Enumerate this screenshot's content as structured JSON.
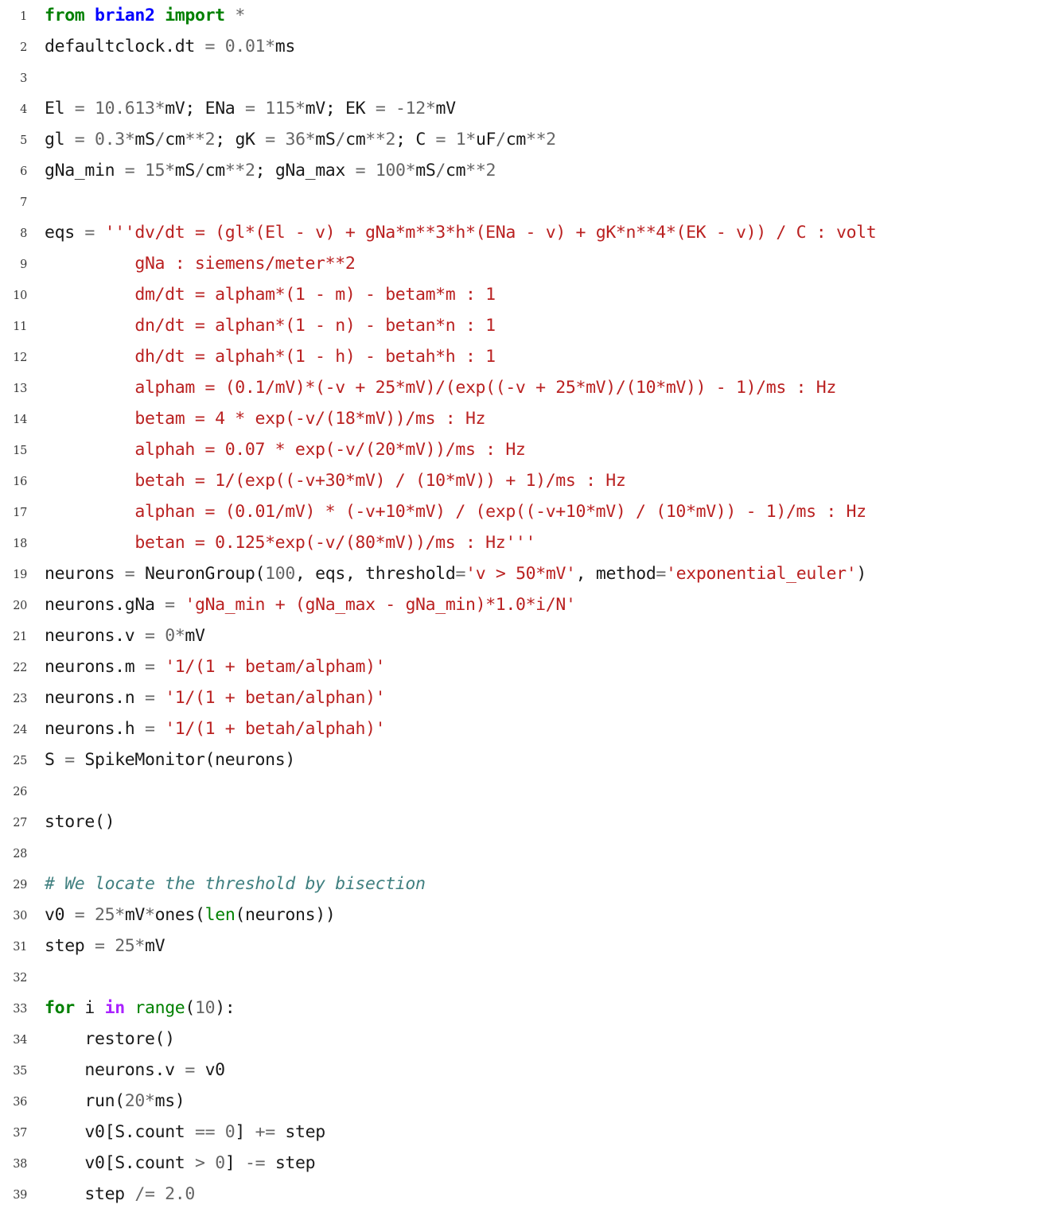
{
  "listing": {
    "language": "python",
    "colors": {
      "keyword": "#008000",
      "namespace": "#0000ff",
      "builtin": "#008000",
      "operator_word": "#aa22ff",
      "string": "#ba2121",
      "comment": "#408080",
      "number": "#666666",
      "name": "#1a1a1a",
      "lineno": "#3a3a3a",
      "background": "#ffffff"
    },
    "first_line_number": 1,
    "last_line_number": 39,
    "lines": [
      {
        "n": "1",
        "text": "from brian2 import *"
      },
      {
        "n": "2",
        "text": "defaultclock.dt = 0.01*ms"
      },
      {
        "n": "3",
        "text": ""
      },
      {
        "n": "4",
        "text": "El = 10.613*mV; ENa = 115*mV; EK = -12*mV"
      },
      {
        "n": "5",
        "text": "gl = 0.3*mS/cm**2; gK = 36*mS/cm**2; C = 1*uF/cm**2"
      },
      {
        "n": "6",
        "text": "gNa_min = 15*mS/cm**2; gNa_max = 100*mS/cm**2"
      },
      {
        "n": "7",
        "text": ""
      },
      {
        "n": "8",
        "text": "eqs = '''dv/dt = (gl*(El - v) + gNa*m**3*h*(ENa - v) + gK*n**4*(EK - v)) / C : volt"
      },
      {
        "n": "9",
        "text": "         gNa : siemens/meter**2"
      },
      {
        "n": "10",
        "text": "         dm/dt = alpham*(1 - m) - betam*m : 1"
      },
      {
        "n": "11",
        "text": "         dn/dt = alphan*(1 - n) - betan*n : 1"
      },
      {
        "n": "12",
        "text": "         dh/dt = alphah*(1 - h) - betah*h : 1"
      },
      {
        "n": "13",
        "text": "         alpham = (0.1/mV)*(-v + 25*mV)/(exp((-v + 25*mV)/(10*mV)) - 1)/ms : Hz"
      },
      {
        "n": "14",
        "text": "         betam = 4 * exp(-v/(18*mV))/ms : Hz"
      },
      {
        "n": "15",
        "text": "         alphah = 0.07 * exp(-v/(20*mV))/ms : Hz"
      },
      {
        "n": "16",
        "text": "         betah = 1/(exp((-v+30*mV) / (10*mV)) + 1)/ms : Hz"
      },
      {
        "n": "17",
        "text": "         alphan = (0.01/mV) * (-v+10*mV) / (exp((-v+10*mV) / (10*mV)) - 1)/ms : Hz"
      },
      {
        "n": "18",
        "text": "         betan = 0.125*exp(-v/(80*mV))/ms : Hz'''"
      },
      {
        "n": "19",
        "text": "neurons = NeuronGroup(100, eqs, threshold='v > 50*mV', method='exponential_euler')"
      },
      {
        "n": "20",
        "text": "neurons.gNa = 'gNa_min + (gNa_max - gNa_min)*1.0*i/N'"
      },
      {
        "n": "21",
        "text": "neurons.v = 0*mV"
      },
      {
        "n": "22",
        "text": "neurons.m = '1/(1 + betam/alpham)'"
      },
      {
        "n": "23",
        "text": "neurons.n = '1/(1 + betan/alphan)'"
      },
      {
        "n": "24",
        "text": "neurons.h = '1/(1 + betah/alphah)'"
      },
      {
        "n": "25",
        "text": "S = SpikeMonitor(neurons)"
      },
      {
        "n": "26",
        "text": ""
      },
      {
        "n": "27",
        "text": "store()"
      },
      {
        "n": "28",
        "text": ""
      },
      {
        "n": "29",
        "text": "# We locate the threshold by bisection"
      },
      {
        "n": "30",
        "text": "v0 = 25*mV*ones(len(neurons))"
      },
      {
        "n": "31",
        "text": "step = 25*mV"
      },
      {
        "n": "32",
        "text": ""
      },
      {
        "n": "33",
        "text": "for i in range(10):"
      },
      {
        "n": "34",
        "text": "    restore()"
      },
      {
        "n": "35",
        "text": "    neurons.v = v0"
      },
      {
        "n": "36",
        "text": "    run(20*ms)"
      },
      {
        "n": "37",
        "text": "    v0[S.count == 0] += step"
      },
      {
        "n": "38",
        "text": "    v0[S.count > 0] -= step"
      },
      {
        "n": "39",
        "text": "    step /= 2.0"
      }
    ],
    "tokens": [
      [
        {
          "t": "kn",
          "v": "from"
        },
        {
          "t": "n",
          "v": " "
        },
        {
          "t": "nn",
          "v": "brian2"
        },
        {
          "t": "n",
          "v": " "
        },
        {
          "t": "kn",
          "v": "import"
        },
        {
          "t": "o",
          "v": " *"
        }
      ],
      [
        {
          "t": "n",
          "v": "defaultclock"
        },
        {
          "t": "p",
          "v": "."
        },
        {
          "t": "n",
          "v": "dt "
        },
        {
          "t": "o",
          "v": "="
        },
        {
          "t": "n",
          "v": " "
        },
        {
          "t": "m",
          "v": "0.01"
        },
        {
          "t": "o",
          "v": "*"
        },
        {
          "t": "n",
          "v": "ms"
        }
      ],
      [],
      [
        {
          "t": "n",
          "v": "El "
        },
        {
          "t": "o",
          "v": "="
        },
        {
          "t": "n",
          "v": " "
        },
        {
          "t": "m",
          "v": "10.613"
        },
        {
          "t": "o",
          "v": "*"
        },
        {
          "t": "n",
          "v": "mV"
        },
        {
          "t": "p",
          "v": ";"
        },
        {
          "t": "n",
          "v": " ENa "
        },
        {
          "t": "o",
          "v": "="
        },
        {
          "t": "n",
          "v": " "
        },
        {
          "t": "m",
          "v": "115"
        },
        {
          "t": "o",
          "v": "*"
        },
        {
          "t": "n",
          "v": "mV"
        },
        {
          "t": "p",
          "v": ";"
        },
        {
          "t": "n",
          "v": " EK "
        },
        {
          "t": "o",
          "v": "="
        },
        {
          "t": "n",
          "v": " "
        },
        {
          "t": "o",
          "v": "-"
        },
        {
          "t": "m",
          "v": "12"
        },
        {
          "t": "o",
          "v": "*"
        },
        {
          "t": "n",
          "v": "mV"
        }
      ],
      [
        {
          "t": "n",
          "v": "gl "
        },
        {
          "t": "o",
          "v": "="
        },
        {
          "t": "n",
          "v": " "
        },
        {
          "t": "m",
          "v": "0.3"
        },
        {
          "t": "o",
          "v": "*"
        },
        {
          "t": "n",
          "v": "mS"
        },
        {
          "t": "o",
          "v": "/"
        },
        {
          "t": "n",
          "v": "cm"
        },
        {
          "t": "o",
          "v": "**"
        },
        {
          "t": "m",
          "v": "2"
        },
        {
          "t": "p",
          "v": ";"
        },
        {
          "t": "n",
          "v": " gK "
        },
        {
          "t": "o",
          "v": "="
        },
        {
          "t": "n",
          "v": " "
        },
        {
          "t": "m",
          "v": "36"
        },
        {
          "t": "o",
          "v": "*"
        },
        {
          "t": "n",
          "v": "mS"
        },
        {
          "t": "o",
          "v": "/"
        },
        {
          "t": "n",
          "v": "cm"
        },
        {
          "t": "o",
          "v": "**"
        },
        {
          "t": "m",
          "v": "2"
        },
        {
          "t": "p",
          "v": ";"
        },
        {
          "t": "n",
          "v": " C "
        },
        {
          "t": "o",
          "v": "="
        },
        {
          "t": "n",
          "v": " "
        },
        {
          "t": "m",
          "v": "1"
        },
        {
          "t": "o",
          "v": "*"
        },
        {
          "t": "n",
          "v": "uF"
        },
        {
          "t": "o",
          "v": "/"
        },
        {
          "t": "n",
          "v": "cm"
        },
        {
          "t": "o",
          "v": "**"
        },
        {
          "t": "m",
          "v": "2"
        }
      ],
      [
        {
          "t": "n",
          "v": "gNa_min "
        },
        {
          "t": "o",
          "v": "="
        },
        {
          "t": "n",
          "v": " "
        },
        {
          "t": "m",
          "v": "15"
        },
        {
          "t": "o",
          "v": "*"
        },
        {
          "t": "n",
          "v": "mS"
        },
        {
          "t": "o",
          "v": "/"
        },
        {
          "t": "n",
          "v": "cm"
        },
        {
          "t": "o",
          "v": "**"
        },
        {
          "t": "m",
          "v": "2"
        },
        {
          "t": "p",
          "v": ";"
        },
        {
          "t": "n",
          "v": " gNa_max "
        },
        {
          "t": "o",
          "v": "="
        },
        {
          "t": "n",
          "v": " "
        },
        {
          "t": "m",
          "v": "100"
        },
        {
          "t": "o",
          "v": "*"
        },
        {
          "t": "n",
          "v": "mS"
        },
        {
          "t": "o",
          "v": "/"
        },
        {
          "t": "n",
          "v": "cm"
        },
        {
          "t": "o",
          "v": "**"
        },
        {
          "t": "m",
          "v": "2"
        }
      ],
      [],
      [
        {
          "t": "n",
          "v": "eqs "
        },
        {
          "t": "o",
          "v": "="
        },
        {
          "t": "n",
          "v": " "
        },
        {
          "t": "s",
          "v": "'''dv/dt = (gl*(El - v) + gNa*m**3*h*(ENa - v) + gK*n**4*(EK - v)) / C : volt"
        }
      ],
      [
        {
          "t": "s",
          "v": "         gNa : siemens/meter**2"
        }
      ],
      [
        {
          "t": "s",
          "v": "         dm/dt = alpham*(1 - m) - betam*m : 1"
        }
      ],
      [
        {
          "t": "s",
          "v": "         dn/dt = alphan*(1 - n) - betan*n : 1"
        }
      ],
      [
        {
          "t": "s",
          "v": "         dh/dt = alphah*(1 - h) - betah*h : 1"
        }
      ],
      [
        {
          "t": "s",
          "v": "         alpham = (0.1/mV)*(-v + 25*mV)/(exp((-v + 25*mV)/(10*mV)) - 1)/ms : Hz"
        }
      ],
      [
        {
          "t": "s",
          "v": "         betam = 4 * exp(-v/(18*mV))/ms : Hz"
        }
      ],
      [
        {
          "t": "s",
          "v": "         alphah = 0.07 * exp(-v/(20*mV))/ms : Hz"
        }
      ],
      [
        {
          "t": "s",
          "v": "         betah = 1/(exp((-v+30*mV) / (10*mV)) + 1)/ms : Hz"
        }
      ],
      [
        {
          "t": "s",
          "v": "         alphan = (0.01/mV) * (-v+10*mV) / (exp((-v+10*mV) / (10*mV)) - 1)/ms : Hz"
        }
      ],
      [
        {
          "t": "s",
          "v": "         betan = 0.125*exp(-v/(80*mV))/ms : Hz'''"
        }
      ],
      [
        {
          "t": "n",
          "v": "neurons "
        },
        {
          "t": "o",
          "v": "="
        },
        {
          "t": "n",
          "v": " NeuronGroup"
        },
        {
          "t": "p",
          "v": "("
        },
        {
          "t": "m",
          "v": "100"
        },
        {
          "t": "p",
          "v": ","
        },
        {
          "t": "n",
          "v": " eqs"
        },
        {
          "t": "p",
          "v": ","
        },
        {
          "t": "n",
          "v": " threshold"
        },
        {
          "t": "o",
          "v": "="
        },
        {
          "t": "s",
          "v": "'v > 50*mV'"
        },
        {
          "t": "p",
          "v": ","
        },
        {
          "t": "n",
          "v": " method"
        },
        {
          "t": "o",
          "v": "="
        },
        {
          "t": "s",
          "v": "'exponential_euler'"
        },
        {
          "t": "p",
          "v": ")"
        }
      ],
      [
        {
          "t": "n",
          "v": "neurons"
        },
        {
          "t": "p",
          "v": "."
        },
        {
          "t": "n",
          "v": "gNa "
        },
        {
          "t": "o",
          "v": "="
        },
        {
          "t": "n",
          "v": " "
        },
        {
          "t": "s",
          "v": "'gNa_min + (gNa_max - gNa_min)*1.0*i/N'"
        }
      ],
      [
        {
          "t": "n",
          "v": "neurons"
        },
        {
          "t": "p",
          "v": "."
        },
        {
          "t": "n",
          "v": "v "
        },
        {
          "t": "o",
          "v": "="
        },
        {
          "t": "n",
          "v": " "
        },
        {
          "t": "m",
          "v": "0"
        },
        {
          "t": "o",
          "v": "*"
        },
        {
          "t": "n",
          "v": "mV"
        }
      ],
      [
        {
          "t": "n",
          "v": "neurons"
        },
        {
          "t": "p",
          "v": "."
        },
        {
          "t": "n",
          "v": "m "
        },
        {
          "t": "o",
          "v": "="
        },
        {
          "t": "n",
          "v": " "
        },
        {
          "t": "s",
          "v": "'1/(1 + betam/alpham)'"
        }
      ],
      [
        {
          "t": "n",
          "v": "neurons"
        },
        {
          "t": "p",
          "v": "."
        },
        {
          "t": "n",
          "v": "n "
        },
        {
          "t": "o",
          "v": "="
        },
        {
          "t": "n",
          "v": " "
        },
        {
          "t": "s",
          "v": "'1/(1 + betan/alphan)'"
        }
      ],
      [
        {
          "t": "n",
          "v": "neurons"
        },
        {
          "t": "p",
          "v": "."
        },
        {
          "t": "n",
          "v": "h "
        },
        {
          "t": "o",
          "v": "="
        },
        {
          "t": "n",
          "v": " "
        },
        {
          "t": "s",
          "v": "'1/(1 + betah/alphah)'"
        }
      ],
      [
        {
          "t": "n",
          "v": "S "
        },
        {
          "t": "o",
          "v": "="
        },
        {
          "t": "n",
          "v": " SpikeMonitor"
        },
        {
          "t": "p",
          "v": "("
        },
        {
          "t": "n",
          "v": "neurons"
        },
        {
          "t": "p",
          "v": ")"
        }
      ],
      [],
      [
        {
          "t": "n",
          "v": "store"
        },
        {
          "t": "p",
          "v": "()"
        }
      ],
      [],
      [
        {
          "t": "c",
          "v": "# We locate the threshold by bisection"
        }
      ],
      [
        {
          "t": "n",
          "v": "v0 "
        },
        {
          "t": "o",
          "v": "="
        },
        {
          "t": "n",
          "v": " "
        },
        {
          "t": "m",
          "v": "25"
        },
        {
          "t": "o",
          "v": "*"
        },
        {
          "t": "n",
          "v": "mV"
        },
        {
          "t": "o",
          "v": "*"
        },
        {
          "t": "n",
          "v": "ones"
        },
        {
          "t": "p",
          "v": "("
        },
        {
          "t": "nb",
          "v": "len"
        },
        {
          "t": "p",
          "v": "("
        },
        {
          "t": "n",
          "v": "neurons"
        },
        {
          "t": "p",
          "v": "))"
        }
      ],
      [
        {
          "t": "n",
          "v": "step "
        },
        {
          "t": "o",
          "v": "="
        },
        {
          "t": "n",
          "v": " "
        },
        {
          "t": "m",
          "v": "25"
        },
        {
          "t": "o",
          "v": "*"
        },
        {
          "t": "n",
          "v": "mV"
        }
      ],
      [],
      [
        {
          "t": "k",
          "v": "for"
        },
        {
          "t": "n",
          "v": " i "
        },
        {
          "t": "ow",
          "v": "in"
        },
        {
          "t": "n",
          "v": " "
        },
        {
          "t": "nb",
          "v": "range"
        },
        {
          "t": "p",
          "v": "("
        },
        {
          "t": "m",
          "v": "10"
        },
        {
          "t": "p",
          "v": "):"
        }
      ],
      [
        {
          "t": "n",
          "v": "    restore"
        },
        {
          "t": "p",
          "v": "()"
        }
      ],
      [
        {
          "t": "n",
          "v": "    neurons"
        },
        {
          "t": "p",
          "v": "."
        },
        {
          "t": "n",
          "v": "v "
        },
        {
          "t": "o",
          "v": "="
        },
        {
          "t": "n",
          "v": " v0"
        }
      ],
      [
        {
          "t": "n",
          "v": "    run"
        },
        {
          "t": "p",
          "v": "("
        },
        {
          "t": "m",
          "v": "20"
        },
        {
          "t": "o",
          "v": "*"
        },
        {
          "t": "n",
          "v": "ms"
        },
        {
          "t": "p",
          "v": ")"
        }
      ],
      [
        {
          "t": "n",
          "v": "    v0"
        },
        {
          "t": "p",
          "v": "["
        },
        {
          "t": "n",
          "v": "S"
        },
        {
          "t": "p",
          "v": "."
        },
        {
          "t": "n",
          "v": "count "
        },
        {
          "t": "o",
          "v": "=="
        },
        {
          "t": "n",
          "v": " "
        },
        {
          "t": "m",
          "v": "0"
        },
        {
          "t": "p",
          "v": "]"
        },
        {
          "t": "n",
          "v": " "
        },
        {
          "t": "o",
          "v": "+="
        },
        {
          "t": "n",
          "v": " step"
        }
      ],
      [
        {
          "t": "n",
          "v": "    v0"
        },
        {
          "t": "p",
          "v": "["
        },
        {
          "t": "n",
          "v": "S"
        },
        {
          "t": "p",
          "v": "."
        },
        {
          "t": "n",
          "v": "count "
        },
        {
          "t": "o",
          "v": ">"
        },
        {
          "t": "n",
          "v": " "
        },
        {
          "t": "m",
          "v": "0"
        },
        {
          "t": "p",
          "v": "]"
        },
        {
          "t": "n",
          "v": " "
        },
        {
          "t": "o",
          "v": "-="
        },
        {
          "t": "n",
          "v": " step"
        }
      ],
      [
        {
          "t": "n",
          "v": "    step "
        },
        {
          "t": "o",
          "v": "/="
        },
        {
          "t": "n",
          "v": " "
        },
        {
          "t": "m",
          "v": "2.0"
        }
      ]
    ]
  }
}
